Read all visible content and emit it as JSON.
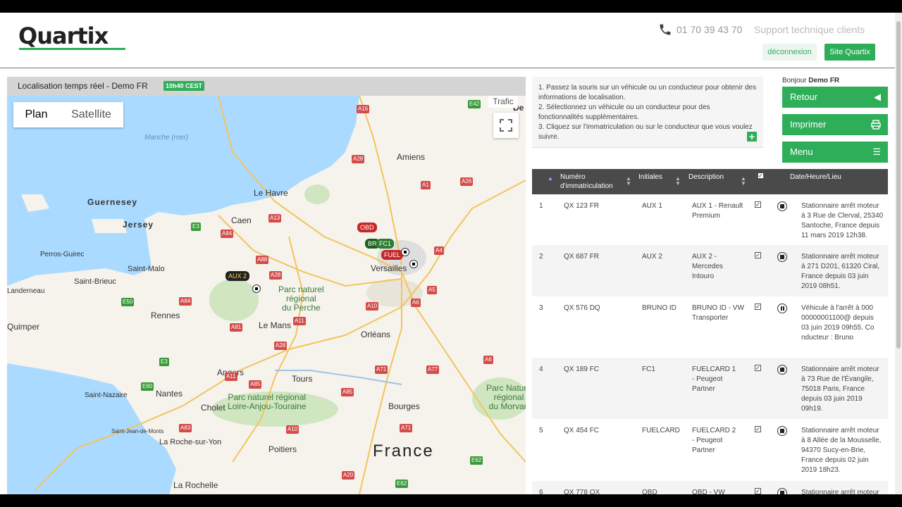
{
  "header": {
    "logo": "Quartix",
    "phone": "01 70 39 43 70",
    "support": "Support technique clients",
    "logout": "déconnexion",
    "site": "Site Quartix"
  },
  "map": {
    "title": "Localisation temps réel - Demo FR",
    "time": "10h40 CEST",
    "toggle_plan": "Plan",
    "toggle_satellite": "Satellite",
    "traffic": "Trafic",
    "labels": {
      "guernesey": "Guernesey",
      "jersey": "Jersey",
      "caen": "Caen",
      "le_havre": "Le Havre",
      "amiens": "Amiens",
      "versailles": "Versailles",
      "perros": "Perros-Guirec",
      "saint_malo": "Saint-Malo",
      "saint_brieuc": "Saint-Brieuc",
      "landerneau": "Landerneau",
      "rennes": "Rennes",
      "le_mans": "Le Mans",
      "orleans": "Orléans",
      "quimper": "Quimper",
      "angers": "Angers",
      "tours": "Tours",
      "nantes": "Nantes",
      "cholet": "Cholet",
      "saint_nazaire": "Saint-Nazaire",
      "bourges": "Bourges",
      "poitiers": "Poitiers",
      "la_roche": "La Roche-sur-Yon",
      "saint_jean": "Saint-Jean-de-Monts",
      "la_rochelle": "La Rochelle",
      "france": "France",
      "manche": "Manche (mer)",
      "perche": "Parc naturel\nrégional\ndu Perche",
      "loire": "Parc naturel régional\nLoire-Anjou-Touraine",
      "morvan": "Parc Nature\nrégional\ndu Morvan",
      "de": "De"
    },
    "roads": [
      "A16",
      "E42",
      "A28",
      "A1",
      "A26",
      "A13",
      "E3",
      "A84",
      "A88",
      "A28",
      "A4",
      "A5",
      "A6",
      "A10",
      "E50",
      "A84",
      "A11",
      "A81",
      "A28",
      "E3",
      "A71",
      "A77",
      "A6",
      "E60",
      "A85",
      "A11",
      "A85",
      "A83",
      "A10",
      "A71",
      "E62",
      "A20",
      "E62"
    ],
    "vehicles": [
      "OBD",
      "BR",
      "FC1",
      "FUEL",
      "AUX 2"
    ]
  },
  "instructions": [
    "1. Passez la souris sur un véhicule ou un conducteur pour obtenir des informations de localisation.",
    "2. Sélectionnez un véhicule ou un conducteur pour des fonctionnalités supplémentaires.",
    "3. Cliquez sur l'immatriculation ou sur le conducteur que vous voulez suivre."
  ],
  "user": {
    "greeting": "Bonjour",
    "name": "Demo FR"
  },
  "side_buttons": {
    "back": "Retour",
    "print": "Imprimer",
    "menu": "Menu"
  },
  "table": {
    "headers": {
      "plate": "Numéro d'immatriculation",
      "initials": "Initiales",
      "description": "Description",
      "location": "Date/Heure/Lieu"
    },
    "rows": [
      {
        "n": "1",
        "plate": "QX 123 FR",
        "initials": "AUX 1",
        "description": "AUX 1 - Renault Premium",
        "status": "stop",
        "location": "Stationnaire arrêt moteur à 3 Rue de Clerval, 25340 Santoche, France depuis 11 mars 2019 12h38."
      },
      {
        "n": "2",
        "plate": "QX 687 FR",
        "initials": "AUX 2",
        "description": "AUX 2 - Mercedes Intouro",
        "status": "stop",
        "location": "Stationnaire arrêt moteur à 271 D201, 61320 Ciral, France depuis 03 juin 2019 08h51."
      },
      {
        "n": "3",
        "plate": "QX 576 DQ",
        "initials": "BRUNO ID",
        "description": "BRUNO ID - VW Transporter",
        "status": "pause",
        "location": "Véhicule à l'arrêt à 00000000001100@ depuis 03 juin 2019 09h55. Conducteur : Bruno"
      },
      {
        "n": "4",
        "plate": "QX 189 FC",
        "initials": "FC1",
        "description": "FUELCARD 1 - Peugeot Partner",
        "status": "stop",
        "location": "Stationnaire arrêt moteur à 73 Rue de l'Évangile, 75018 Paris, France depuis 03 juin 2019 09h19."
      },
      {
        "n": "5",
        "plate": "QX 454 FC",
        "initials": "FUELCARD",
        "description": "FUELCARD 2 - Peugeot Partner",
        "status": "stop",
        "location": "Stationnaire arrêt moteur à 8 Allée de la Mousselle, 94370 Sucy-en-Brie, France depuis 02 juin 2019 18h23."
      },
      {
        "n": "6",
        "plate": "QX 778 QX",
        "initials": "OBD",
        "description": "OBD - VW",
        "status": "stop",
        "location": "Stationnaire arrêt moteur"
      }
    ]
  }
}
